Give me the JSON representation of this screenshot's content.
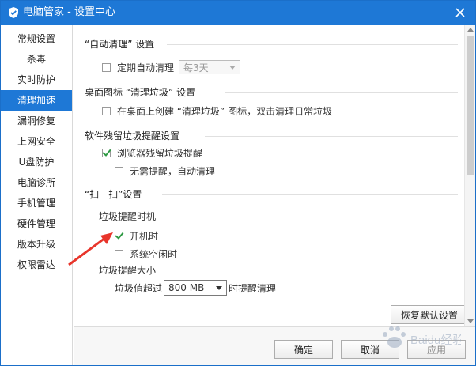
{
  "window": {
    "title": "电脑管家 - 设置中心",
    "accent_color": "#1e78d6",
    "app_icon": "shield-icon",
    "close_icon": "close-icon"
  },
  "sidebar": {
    "items": [
      {
        "label": "常规设置",
        "active": false
      },
      {
        "label": "杀毒",
        "active": false
      },
      {
        "label": "实时防护",
        "active": false
      },
      {
        "label": "清理加速",
        "active": true
      },
      {
        "label": "漏洞修复",
        "active": false
      },
      {
        "label": "上网安全",
        "active": false
      },
      {
        "label": "U盘防护",
        "active": false
      },
      {
        "label": "电脑诊所",
        "active": false
      },
      {
        "label": "手机管理",
        "active": false
      },
      {
        "label": "硬件管理",
        "active": false
      },
      {
        "label": "版本升级",
        "active": false
      },
      {
        "label": "权限雷达",
        "active": false
      }
    ]
  },
  "sections": {
    "auto_clean": {
      "title": "“自动清理” 设置",
      "option_label": "定期自动清理",
      "checked": false,
      "interval_value": "每3天"
    },
    "desktop_icon": {
      "title": "桌面图标 “清理垃圾” 设置",
      "option_label": "在桌面上创建 “清理垃圾” 图标，双击清理日常垃圾",
      "checked": false
    },
    "residual": {
      "title": "软件残留垃圾提醒设置",
      "option_label": "浏览器残留垃圾提醒",
      "checked": true,
      "sub_option_label": "无需提醒，自动清理",
      "sub_checked": false
    },
    "scan": {
      "title": "“扫一扫”设置",
      "timing_label": "垃圾提醒时机",
      "startup_label": "开机时",
      "startup_checked": true,
      "idle_label": "系统空闲时",
      "idle_checked": false,
      "size_label": "垃圾提醒大小",
      "threshold_prefix": "垃圾值超过",
      "threshold_value": "800 MB",
      "threshold_suffix": "时提醒清理"
    }
  },
  "buttons": {
    "restore_default": "恢复默认设置",
    "ok": "确定",
    "cancel": "取消",
    "apply": "应用"
  },
  "annotation": {
    "arrow_color": "#e8352b"
  },
  "watermark": {
    "text": "Baidu经验"
  }
}
